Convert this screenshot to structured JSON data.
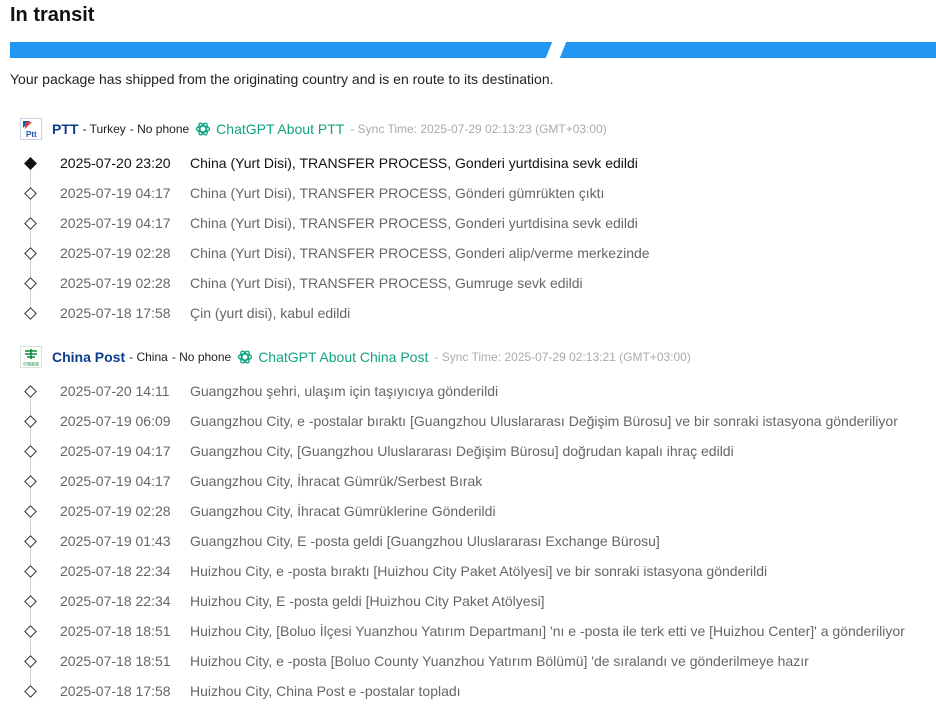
{
  "status": {
    "title": "In transit",
    "progress": 0.59,
    "description": "Your package has shipped from the originating country and is en route to its destination."
  },
  "colors": {
    "progress": "#2196f3",
    "carrier_name": "#0d3c8c",
    "chatgpt_link": "#10a37f",
    "sync_text": "#aaaaaa"
  },
  "carriers": [
    {
      "logo_text": "Ptt",
      "logo_icon": "ptt-logo-icon",
      "name": "PTT",
      "country": "- Turkey",
      "phone": "- No phone",
      "chatgpt_label": "ChatGPT About PTT",
      "sync": "- Sync Time: 2025-07-29 02:13:23 (GMT+03:00)",
      "events": [
        {
          "time": "2025-07-20 23:20",
          "desc": "China (Yurt Disi), TRANSFER PROCESS, Gonderi yurtdisina sevk edildi"
        },
        {
          "time": "2025-07-19 04:17",
          "desc": "China (Yurt Disi), TRANSFER PROCESS, Gönderi gümrükten çıktı"
        },
        {
          "time": "2025-07-19 04:17",
          "desc": "China (Yurt Disi), TRANSFER PROCESS, Gonderi yurtdisina sevk edildi"
        },
        {
          "time": "2025-07-19 02:28",
          "desc": "China (Yurt Disi), TRANSFER PROCESS, Gonderi alip/verme merkezinde"
        },
        {
          "time": "2025-07-19 02:28",
          "desc": "China (Yurt Disi), TRANSFER PROCESS, Gumruge sevk edildi"
        },
        {
          "time": "2025-07-18 17:58",
          "desc": "Çin (yurt disi), kabul edildi"
        }
      ]
    },
    {
      "logo_text": "中国邮政",
      "logo_icon": "china-post-logo-icon",
      "name": "China Post",
      "country": "- China",
      "phone": "- No phone",
      "chatgpt_label": "ChatGPT About China Post",
      "sync": "- Sync Time: 2025-07-29 02:13:21 (GMT+03:00)",
      "events": [
        {
          "time": "2025-07-20 14:11",
          "desc": "Guangzhou şehri, ulaşım için taşıyıcıya gönderildi"
        },
        {
          "time": "2025-07-19 06:09",
          "desc": "Guangzhou City, e -postalar bıraktı [Guangzhou Uluslararası Değişim Bürosu] ve bir sonraki istasyona gönderiliyor"
        },
        {
          "time": "2025-07-19 04:17",
          "desc": "Guangzhou City, [Guangzhou Uluslararası Değişim Bürosu] doğrudan kapalı ihraç edildi"
        },
        {
          "time": "2025-07-19 04:17",
          "desc": "Guangzhou City, İhracat Gümrük/Serbest Bırak"
        },
        {
          "time": "2025-07-19 02:28",
          "desc": "Guangzhou City, İhracat Gümrüklerine Gönderildi"
        },
        {
          "time": "2025-07-19 01:43",
          "desc": "Guangzhou City, E -posta geldi [Guangzhou Uluslararası Exchange Bürosu]"
        },
        {
          "time": "2025-07-18 22:34",
          "desc": "Huizhou City, e -posta bıraktı [Huizhou City Paket Atölyesi] ve bir sonraki istasyona gönderildi"
        },
        {
          "time": "2025-07-18 22:34",
          "desc": "Huizhou City, E -posta geldi [Huizhou City Paket Atölyesi]"
        },
        {
          "time": "2025-07-18 18:51",
          "desc": "Huizhou City, [Boluo İlçesi Yuanzhou Yatırım Departmanı] 'nı e -posta ile terk etti ve [Huizhou Center]' a gönderiliyor"
        },
        {
          "time": "2025-07-18 18:51",
          "desc": "Huizhou City, e -posta [Boluo County Yuanzhou Yatırım Bölümü] 'de sıralandı ve gönderilmeye hazır"
        },
        {
          "time": "2025-07-18 17:58",
          "desc": "Huizhou City, China Post e -postalar topladı"
        }
      ]
    }
  ]
}
